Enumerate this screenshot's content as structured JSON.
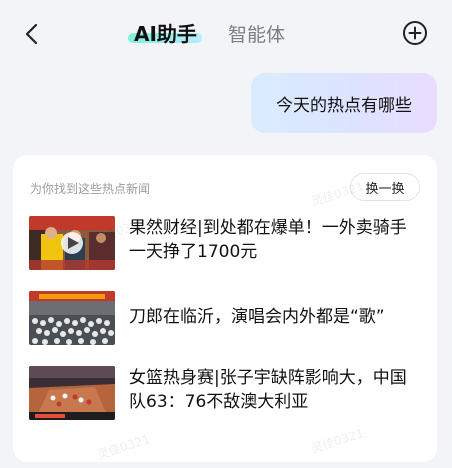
{
  "header": {
    "back_icon": "chevron-left-icon",
    "tabs": [
      {
        "label": "AI助手",
        "active": true
      },
      {
        "label": "智能体",
        "active": false
      }
    ],
    "add_icon": "plus-circle-icon",
    "accent_gradient": [
      "#7ff0d8",
      "#b8ecff"
    ]
  },
  "chat": {
    "user_message": "今天的热点有哪些"
  },
  "news_card": {
    "hint": "为你找到这些热点新闻",
    "refresh_label": "换一换",
    "items": [
      {
        "title": "果然财经|到处都在爆单！一外卖骑手一天挣了1700元",
        "thumb_icon": "video-thumbnail-crowd"
      },
      {
        "title": "刀郎在临沂，演唱会内外都是“歌”",
        "thumb_icon": "concert-thumbnail"
      },
      {
        "title": "女篮热身赛|张子宇缺阵影响大，中国队63：76不敌澳大利亚",
        "thumb_icon": "basketball-thumbnail"
      }
    ]
  },
  "watermark": "灵佳0321"
}
